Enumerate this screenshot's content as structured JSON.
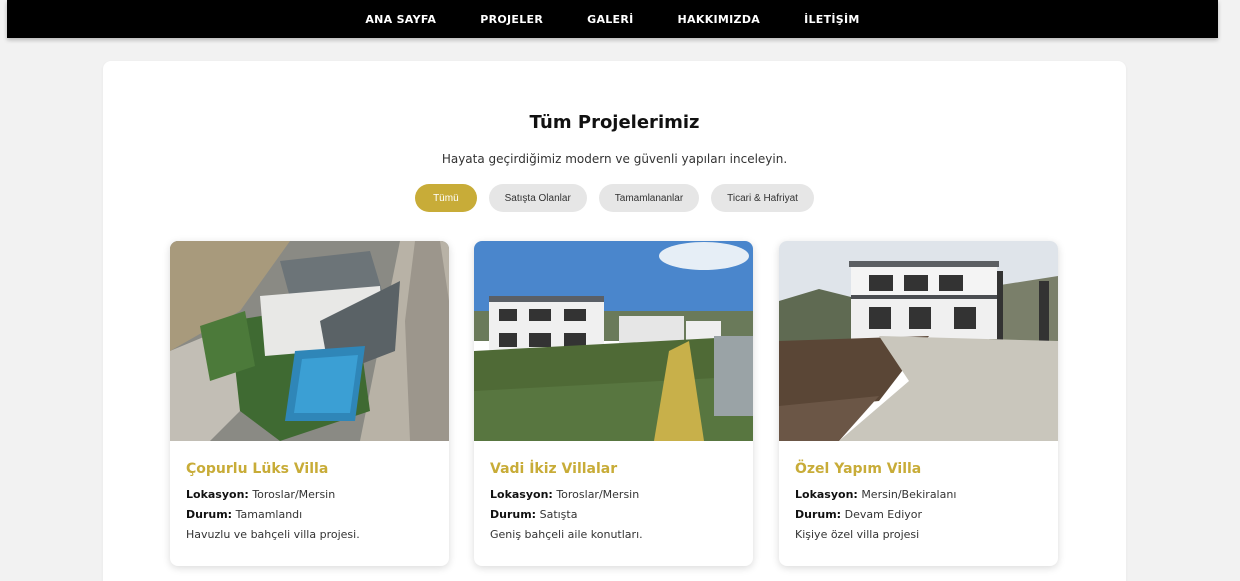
{
  "nav": {
    "items": [
      "ANA SAYFA",
      "PROJELER",
      "GALERİ",
      "HAKKIMIZDA",
      "İLETİŞİM"
    ]
  },
  "page": {
    "title": "Tüm Projelerimiz",
    "subtitle": "Hayata geçirdiğimiz modern ve güvenli yapıları inceleyin."
  },
  "filters": [
    "Tümü",
    "Satışta Olanlar",
    "Tamamlananlar",
    "Ticari & Hafriyat"
  ],
  "labels": {
    "location": "Lokasyon:",
    "status": "Durum:"
  },
  "projects": [
    {
      "title": "Çopurlu Lüks Villa",
      "location": "Toroslar/Mersin",
      "status": "Tamamlandı",
      "description": "Havuzlu ve bahçeli villa projesi."
    },
    {
      "title": "Vadi İkiz Villalar",
      "location": "Toroslar/Mersin",
      "status": "Satışta",
      "description": "Geniş bahçeli aile konutları."
    },
    {
      "title": "Özel Yapım Villa",
      "location": "Mersin/Bekiralanı",
      "status": "Devam Ediyor",
      "description": "Kişiye özel villa projesi"
    }
  ],
  "colors": {
    "accent": "#c8ac38",
    "nav_bg": "#000000"
  }
}
